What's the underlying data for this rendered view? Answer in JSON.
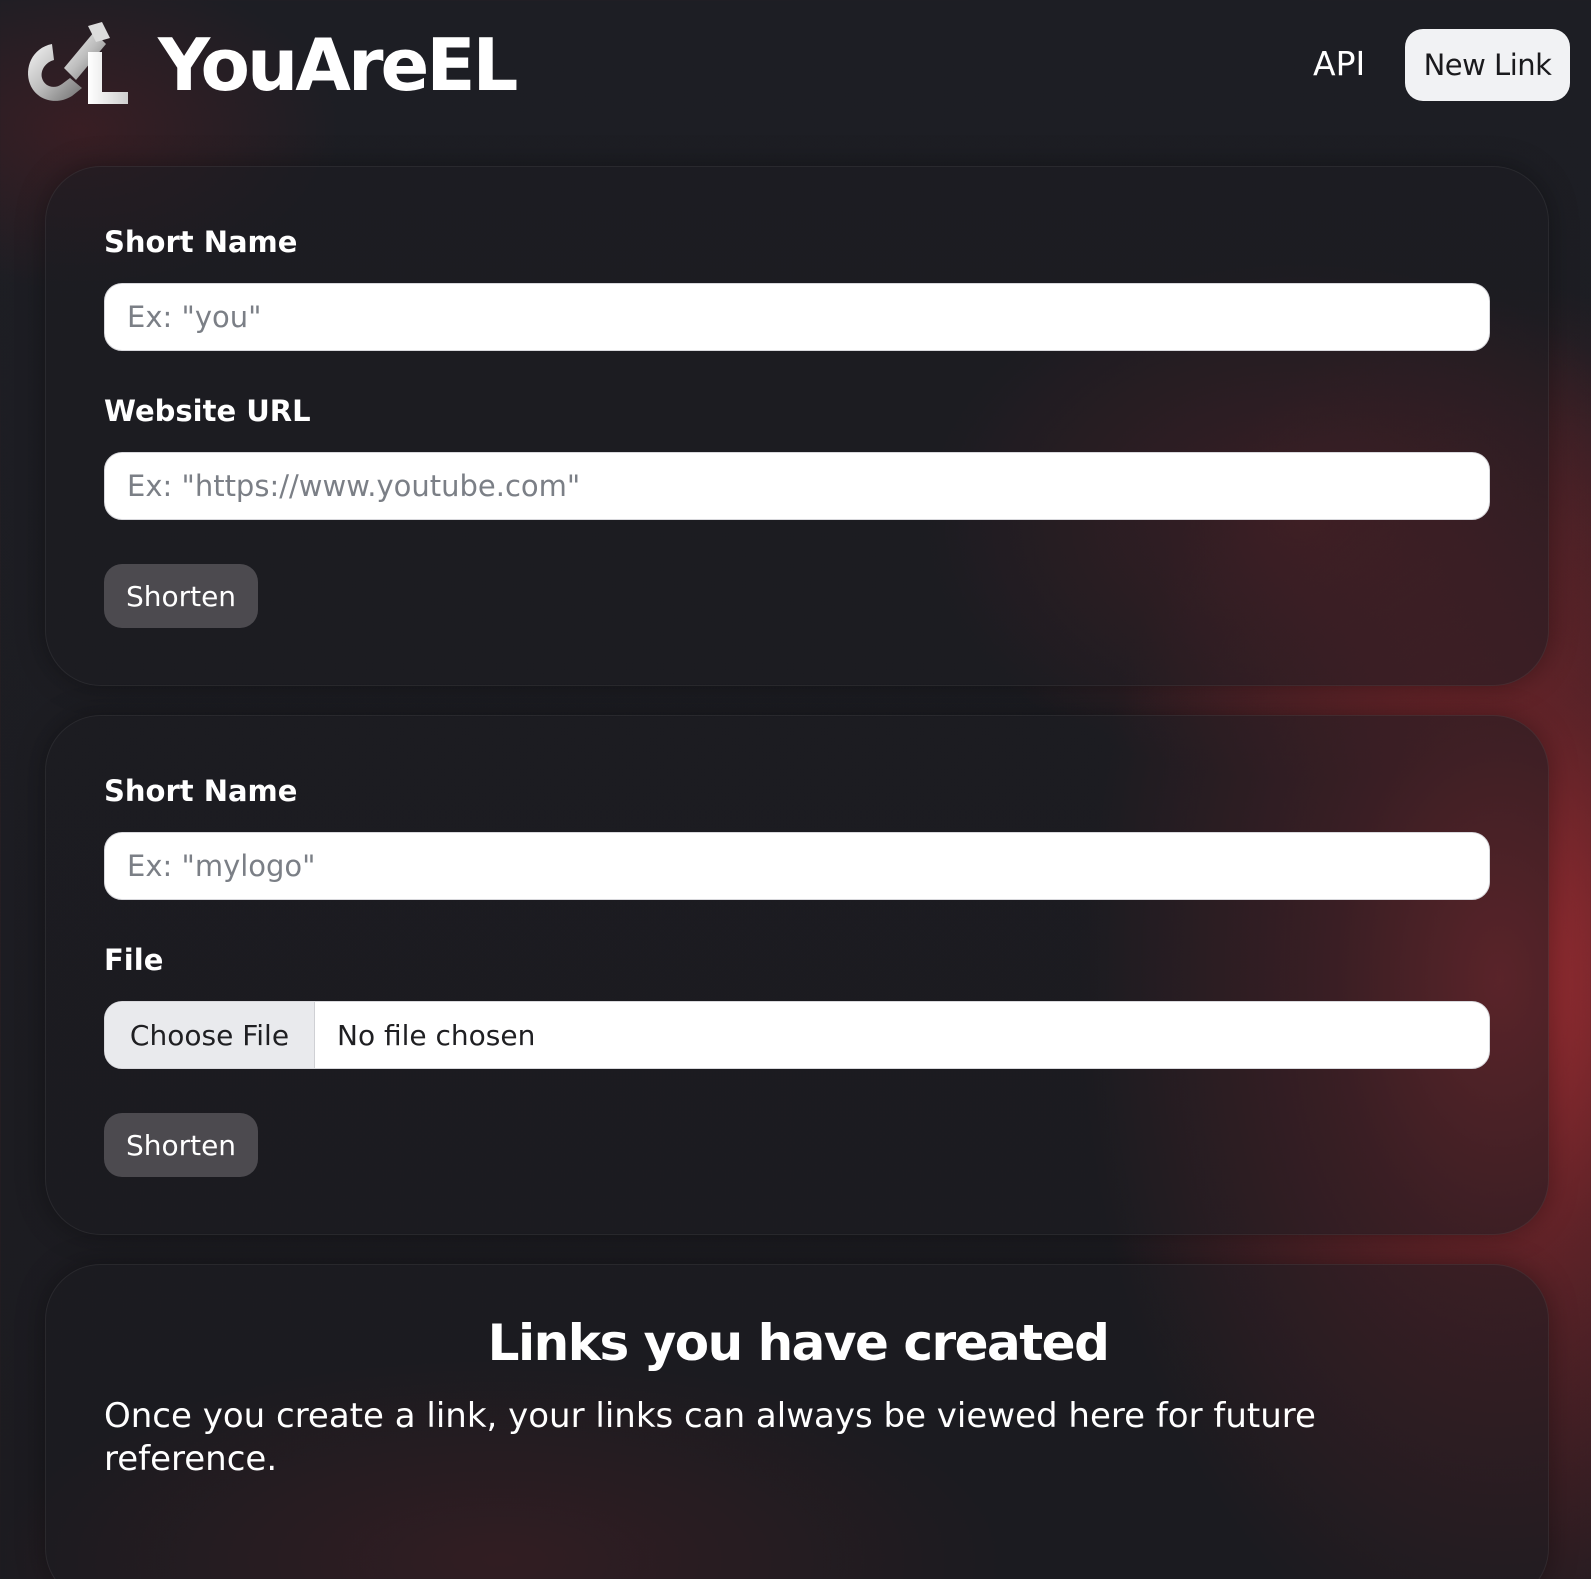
{
  "header": {
    "brand": "YouAreEL",
    "logo_icon": "youareel-logo-icon",
    "nav_api": "API",
    "new_link_button": "New Link"
  },
  "url_form": {
    "short_name_label": "Short Name",
    "short_name_placeholder": "Ex: \"you\"",
    "website_url_label": "Website URL",
    "website_url_placeholder": "Ex: \"https://www.youtube.com\"",
    "submit_label": "Shorten"
  },
  "file_form": {
    "short_name_label": "Short Name",
    "short_name_placeholder": "Ex: \"mylogo\"",
    "file_label": "File",
    "choose_file_label": "Choose File",
    "file_status": "No file chosen",
    "submit_label": "Shorten"
  },
  "links_section": {
    "title": "Links you have created",
    "description": "Once you create a link, your links can always be viewed here for future reference."
  },
  "colors": {
    "background": "#1c1b20",
    "accent_red": "#b8363a",
    "button_dark": "#4c4a4f",
    "button_light": "#f1f2f4",
    "input_placeholder": "#7b7f86"
  }
}
